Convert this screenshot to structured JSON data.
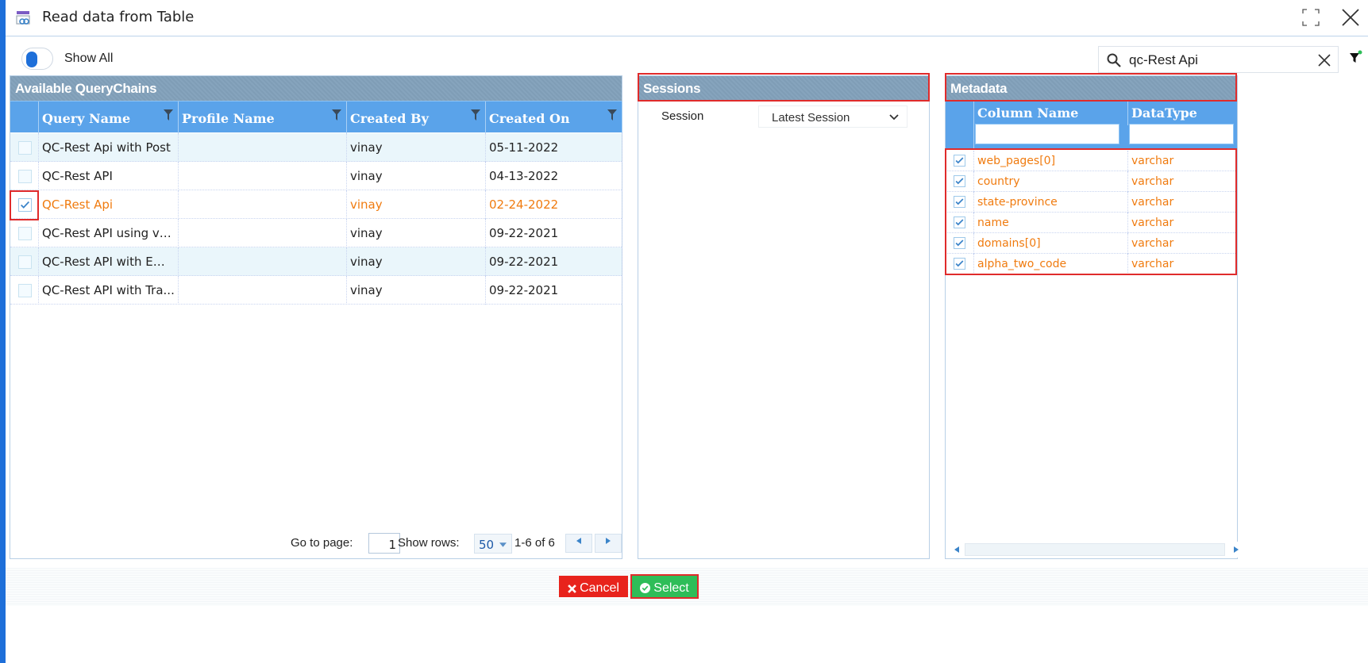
{
  "window": {
    "title": "Read data from Table"
  },
  "toolbar": {
    "show_all_label": "Show All",
    "search_value": "qc-Rest Api"
  },
  "querychains": {
    "title": "Available QueryChains",
    "columns": [
      "Query Name",
      "Profile Name",
      "Created By",
      "Created On"
    ],
    "rows": [
      {
        "query_name": "QC-Rest Api with Post",
        "profile_name": "",
        "created_by": "vinay",
        "created_on": "05-11-2022",
        "checked": false
      },
      {
        "query_name": "QC-Rest API",
        "profile_name": "",
        "created_by": "vinay",
        "created_on": "04-13-2022",
        "checked": false
      },
      {
        "query_name": "QC-Rest Api",
        "profile_name": "",
        "created_by": "vinay",
        "created_on": "02-24-2022",
        "checked": true
      },
      {
        "query_name": "QC-Rest API using var...",
        "profile_name": "",
        "created_by": "vinay",
        "created_on": "09-22-2021",
        "checked": false
      },
      {
        "query_name": "QC-Rest API with Email",
        "profile_name": "",
        "created_by": "vinay",
        "created_on": "09-22-2021",
        "checked": false
      },
      {
        "query_name": "QC-Rest API with Tra...",
        "profile_name": "",
        "created_by": "vinay",
        "created_on": "09-22-2021",
        "checked": false
      }
    ],
    "pager": {
      "go_to_label": "Go to page:",
      "page": "1",
      "show_rows_label": "Show rows:",
      "rows_per_page": "50",
      "range": "1-6 of 6"
    }
  },
  "sessions": {
    "title": "Sessions",
    "session_label": "Session",
    "session_value": "Latest Session"
  },
  "metadata": {
    "title": "Metadata",
    "columns": [
      "Column Name",
      "DataType"
    ],
    "rows": [
      {
        "name": "web_pages[0]",
        "type": "varchar"
      },
      {
        "name": "country",
        "type": "varchar"
      },
      {
        "name": "state-province",
        "type": "varchar"
      },
      {
        "name": "name",
        "type": "varchar"
      },
      {
        "name": "domains[0]",
        "type": "varchar"
      },
      {
        "name": "alpha_two_code",
        "type": "varchar"
      }
    ]
  },
  "footer": {
    "cancel_label": "Cancel",
    "select_label": "Select"
  },
  "colors": {
    "accent": "#1e6fd9",
    "grid_header": "#5aa3ea",
    "selected_text": "#f07b0f",
    "cancel": "#e8231c",
    "select": "#2ebd58",
    "highlight": "#e02b2b"
  }
}
